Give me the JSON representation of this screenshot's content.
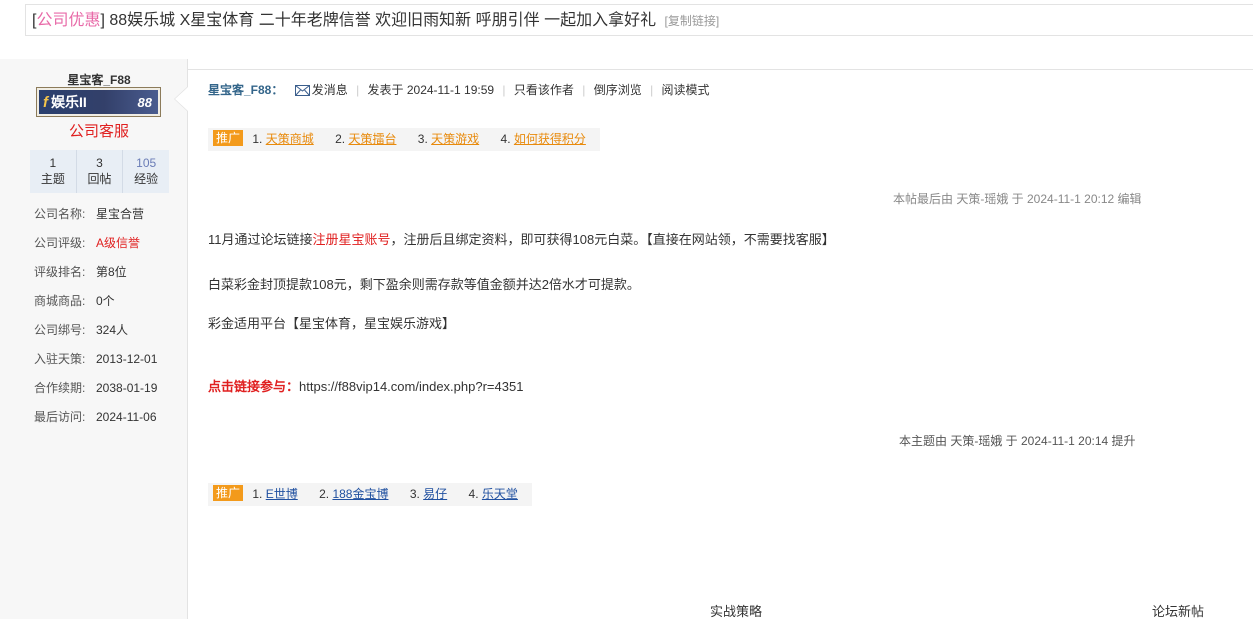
{
  "thread": {
    "category": "公司优惠",
    "bracket_open": "[",
    "bracket_close": "]",
    "title": "88娱乐城 X星宝体育 二十年老牌信誉 欢迎旧雨知新 呼朋引伴 一起加入拿好礼",
    "copy_link": "[复制链接]"
  },
  "sidebar": {
    "username": "星宝客_F88",
    "avatar": {
      "brand_f": "f",
      "brand_text": "娱乐II",
      "brand_88": "88",
      "icon": "f88-logo-icon"
    },
    "group": "公司客服",
    "stats": [
      {
        "value": "1",
        "label": "主题"
      },
      {
        "value": "3",
        "label": "回帖"
      },
      {
        "value": "105",
        "label": "经验"
      }
    ],
    "info": [
      {
        "key": "公司名称:",
        "value": "星宝合营"
      },
      {
        "key": "公司评级:",
        "value": "A级信誉"
      },
      {
        "key": "评级排名:",
        "value": "第8位"
      },
      {
        "key": "商城商品:",
        "value": "0个"
      },
      {
        "key": "公司绑号:",
        "value": "324人"
      },
      {
        "key": "入驻天策:",
        "value": "2013-12-01"
      },
      {
        "key": "合作续期:",
        "value": "2038-01-19"
      },
      {
        "key": "最后访问:",
        "value": "2024-11-06"
      }
    ]
  },
  "post": {
    "author": "星宝客_F88：",
    "send_message": "发消息",
    "posted_at": "发表于 2024-11-1 19:59",
    "only_author": "只看该作者",
    "reverse_order": "倒序浏览",
    "reading_mode": "阅读模式",
    "promo_tag": "推广",
    "promo_top": [
      {
        "num": "1.",
        "label": "天策商城"
      },
      {
        "num": "2.",
        "label": "天策擂台"
      },
      {
        "num": "3.",
        "label": "天策游戏"
      },
      {
        "num": "4.",
        "label": "如何获得积分"
      }
    ],
    "edited_note": "本帖最后由 天策-瑶娥 于 2024-11-1 20:12 编辑",
    "body": {
      "p1_a": "11月通过论坛链接",
      "p1_link": "注册星宝账号",
      "p1_b": "，注册后且绑定资料，即可获得108元白菜。【直接在网站领，不需要找客服】",
      "p2": "白菜彩金封顶提款108元，剩下盈余则需存款等值金额并达2倍水才可提款。",
      "p3": "彩金适用平台【星宝体育，星宝娱乐游戏】",
      "cta_label": "点击链接参与：",
      "cta_url": "https://f88vip14.com/index.php?r=4351"
    },
    "bumped_note": "本主题由 天策-瑶娥 于 2024-11-1 20:14 提升",
    "promo_bottom": [
      {
        "num": "1.",
        "label": "E世博"
      },
      {
        "num": "2.",
        "label": "188金宝博"
      },
      {
        "num": "3.",
        "label": "易仔"
      },
      {
        "num": "4.",
        "label": "乐天堂"
      }
    ]
  },
  "footer": {
    "left_heading": "实战策略",
    "right_heading": "论坛新帖"
  },
  "colors": {
    "category_pink": "#e86aa8",
    "accent_red": "#e02020",
    "author_blue": "#33658a",
    "promo_orange": "#f39a1b"
  }
}
